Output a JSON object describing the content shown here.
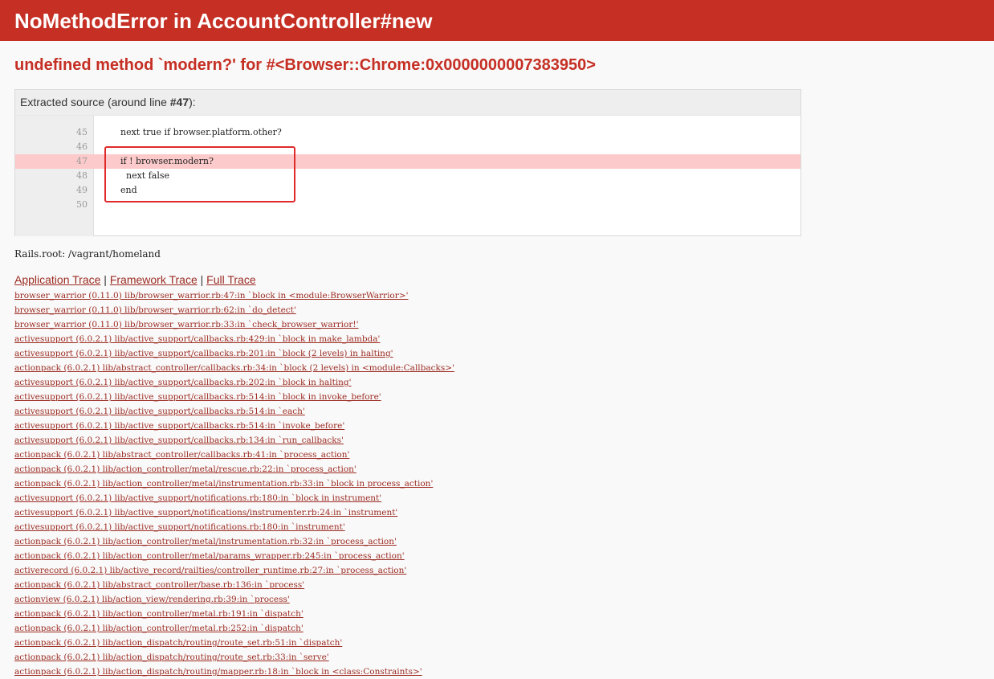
{
  "page": {
    "title": "NoMethodError in AccountController#new",
    "message": "undefined method `modern?' for #<Browser::Chrome:0x0000000007383950>"
  },
  "source": {
    "header_prefix": "Extracted source (around line ",
    "header_line": "#47",
    "header_suffix": "):",
    "lines": [
      {
        "num": "45",
        "code": "next true if browser.platform.other?"
      },
      {
        "num": "46",
        "code": ""
      },
      {
        "num": "47",
        "code": "if ! browser.modern?"
      },
      {
        "num": "48",
        "code": "  next false"
      },
      {
        "num": "49",
        "code": "end"
      },
      {
        "num": "50",
        "code": ""
      }
    ]
  },
  "rails_root": "Rails.root: /vagrant/homeland",
  "trace": {
    "tabs": [
      "Application Trace",
      "Framework Trace",
      "Full Trace"
    ],
    "separator": "|",
    "items": [
      "browser_warrior (0.11.0) lib/browser_warrior.rb:47:in `block in <module:BrowserWarrior>'",
      "browser_warrior (0.11.0) lib/browser_warrior.rb:62:in `do_detect'",
      "browser_warrior (0.11.0) lib/browser_warrior.rb:33:in `check_browser_warrior!'",
      "activesupport (6.0.2.1) lib/active_support/callbacks.rb:429:in `block in make_lambda'",
      "activesupport (6.0.2.1) lib/active_support/callbacks.rb:201:in `block (2 levels) in halting'",
      "actionpack (6.0.2.1) lib/abstract_controller/callbacks.rb:34:in `block (2 levels) in <module:Callbacks>'",
      "activesupport (6.0.2.1) lib/active_support/callbacks.rb:202:in `block in halting'",
      "activesupport (6.0.2.1) lib/active_support/callbacks.rb:514:in `block in invoke_before'",
      "activesupport (6.0.2.1) lib/active_support/callbacks.rb:514:in `each'",
      "activesupport (6.0.2.1) lib/active_support/callbacks.rb:514:in `invoke_before'",
      "activesupport (6.0.2.1) lib/active_support/callbacks.rb:134:in `run_callbacks'",
      "actionpack (6.0.2.1) lib/abstract_controller/callbacks.rb:41:in `process_action'",
      "actionpack (6.0.2.1) lib/action_controller/metal/rescue.rb:22:in `process_action'",
      "actionpack (6.0.2.1) lib/action_controller/metal/instrumentation.rb:33:in `block in process_action'",
      "activesupport (6.0.2.1) lib/active_support/notifications.rb:180:in `block in instrument'",
      "activesupport (6.0.2.1) lib/active_support/notifications/instrumenter.rb:24:in `instrument'",
      "activesupport (6.0.2.1) lib/active_support/notifications.rb:180:in `instrument'",
      "actionpack (6.0.2.1) lib/action_controller/metal/instrumentation.rb:32:in `process_action'",
      "actionpack (6.0.2.1) lib/action_controller/metal/params_wrapper.rb:245:in `process_action'",
      "activerecord (6.0.2.1) lib/active_record/railties/controller_runtime.rb:27:in `process_action'",
      "actionpack (6.0.2.1) lib/abstract_controller/base.rb:136:in `process'",
      "actionview (6.0.2.1) lib/action_view/rendering.rb:39:in `process'",
      "actionpack (6.0.2.1) lib/action_controller/metal.rb:191:in `dispatch'",
      "actionpack (6.0.2.1) lib/action_controller/metal.rb:252:in `dispatch'",
      "actionpack (6.0.2.1) lib/action_dispatch/routing/route_set.rb:51:in `dispatch'",
      "actionpack (6.0.2.1) lib/action_dispatch/routing/route_set.rb:33:in `serve'",
      "actionpack (6.0.2.1) lib/action_dispatch/routing/mapper.rb:18:in `block in <class:Constraints>'"
    ]
  }
}
